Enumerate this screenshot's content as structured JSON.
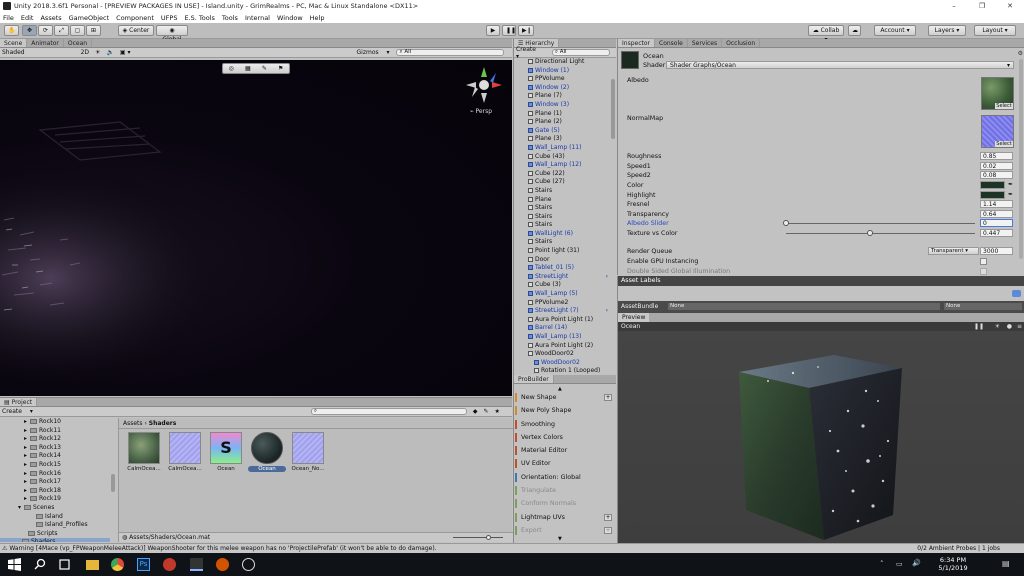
{
  "window": {
    "title": "Unity 2018.3.6f1 Personal - [PREVIEW PACKAGES IN USE] - Island.unity - GrimRealms - PC, Mac & Linux Standalone <DX11>"
  },
  "menu": [
    "File",
    "Edit",
    "Assets",
    "GameObject",
    "Component",
    "UFPS",
    "E.S. Tools",
    "Tools",
    "Internal",
    "Window",
    "Help"
  ],
  "toolbar": {
    "center": "Center",
    "global": "Global",
    "collab": "Collab",
    "account": "Account",
    "layers": "Layers",
    "layout": "Layout"
  },
  "scene": {
    "tabs": [
      "Scene",
      "Animator",
      "Ocean"
    ],
    "shading": "Shaded",
    "mode2d": "2D",
    "gizmos": "Gizmos",
    "search_placeholder": "All",
    "persp": "Persp"
  },
  "hierarchy": {
    "tab": "Hierarchy",
    "create": "Create",
    "search_placeholder": "All",
    "items": [
      {
        "label": "Directional Light",
        "prefab": false
      },
      {
        "label": "Window (1)",
        "prefab": true
      },
      {
        "label": "PPVolume",
        "prefab": false
      },
      {
        "label": "Window (2)",
        "prefab": true
      },
      {
        "label": "Plane (7)",
        "prefab": false
      },
      {
        "label": "Window (3)",
        "prefab": true
      },
      {
        "label": "Plane (1)",
        "prefab": false
      },
      {
        "label": "Plane (2)",
        "prefab": false
      },
      {
        "label": "Gate (5)",
        "prefab": true
      },
      {
        "label": "Plane (3)",
        "prefab": false
      },
      {
        "label": "Wall_Lamp (11)",
        "prefab": true
      },
      {
        "label": "Cube (43)",
        "prefab": false
      },
      {
        "label": "Wall_Lamp (12)",
        "prefab": true
      },
      {
        "label": "Cube (22)",
        "prefab": false
      },
      {
        "label": "Cube (27)",
        "prefab": false
      },
      {
        "label": "Stairs",
        "prefab": false
      },
      {
        "label": "Plane",
        "prefab": false
      },
      {
        "label": "Stairs",
        "prefab": false
      },
      {
        "label": "Stairs",
        "prefab": false
      },
      {
        "label": "Stairs",
        "prefab": false
      },
      {
        "label": "WallLight (6)",
        "prefab": true
      },
      {
        "label": "Stairs",
        "prefab": false
      },
      {
        "label": "Point light (31)",
        "prefab": false
      },
      {
        "label": "Door",
        "prefab": false
      },
      {
        "label": "Tablet_01 (5)",
        "prefab": true
      },
      {
        "label": "StreetLight",
        "prefab": true
      },
      {
        "label": "Cube (3)",
        "prefab": false
      },
      {
        "label": "Wall_Lamp (5)",
        "prefab": true
      },
      {
        "label": "PPVolume2",
        "prefab": false
      },
      {
        "label": "StreetLight (7)",
        "prefab": true
      },
      {
        "label": "Aura Point Light (1)",
        "prefab": false
      },
      {
        "label": "Barrel (14)",
        "prefab": true
      },
      {
        "label": "Wall_Lamp (13)",
        "prefab": true
      },
      {
        "label": "Aura Point Light (2)",
        "prefab": false
      },
      {
        "label": "WoodDoor02",
        "prefab": false
      },
      {
        "label": "WoodDoor02",
        "prefab": true
      },
      {
        "label": "Rotation 1 (Looped)",
        "prefab": false
      }
    ]
  },
  "probuilder": {
    "tab": "ProBuilder",
    "items": [
      {
        "label": "New Shape",
        "color": "#d08a2a",
        "plus": true,
        "disabled": false
      },
      {
        "label": "New Poly Shape",
        "color": "#d08a2a",
        "plus": false,
        "disabled": false
      },
      {
        "label": "Smoothing",
        "color": "#c0502a",
        "plus": false,
        "disabled": false
      },
      {
        "label": "Vertex Colors",
        "color": "#c0502a",
        "plus": false,
        "disabled": false
      },
      {
        "label": "Material Editor",
        "color": "#c0502a",
        "plus": false,
        "disabled": false
      },
      {
        "label": "UV Editor",
        "color": "#c0502a",
        "plus": false,
        "disabled": false
      },
      {
        "label": "Orientation: Global",
        "color": "#3a7ab0",
        "plus": false,
        "disabled": false
      },
      {
        "label": "Triangulate",
        "color": "#7aa05a",
        "plus": false,
        "disabled": true
      },
      {
        "label": "Conform Normals",
        "color": "#7aa05a",
        "plus": false,
        "disabled": true
      },
      {
        "label": "Lightmap UVs",
        "color": "#7aa05a",
        "plus": true,
        "disabled": false
      },
      {
        "label": "Export",
        "color": "#7aa05a",
        "plus": true,
        "disabled": true
      }
    ]
  },
  "inspector": {
    "tabs": [
      "Inspector",
      "Console",
      "Services",
      "Occlusion"
    ],
    "name": "Ocean",
    "shader_label": "Shader",
    "shader": "Shader Graphs/Ocean",
    "albedo": "Albedo",
    "normalmap": "NormalMap",
    "select": "Select",
    "props": [
      {
        "label": "Roughness",
        "value": "0.85",
        "kind": "num"
      },
      {
        "label": "Speed1",
        "value": "0.02",
        "kind": "num"
      },
      {
        "label": "Speed2",
        "value": "0.08",
        "kind": "num"
      },
      {
        "label": "Color",
        "value": "",
        "kind": "color"
      },
      {
        "label": "Highlight",
        "value": "",
        "kind": "color"
      },
      {
        "label": "Fresnel",
        "value": "1.14",
        "kind": "num"
      },
      {
        "label": "Transparency",
        "value": "0.64",
        "kind": "num"
      },
      {
        "label": "Albedo Slider",
        "value": "0",
        "kind": "slider",
        "fraction": 0
      },
      {
        "label": "Texture vs Color",
        "value": "0.447",
        "kind": "slider",
        "fraction": 0.447
      }
    ],
    "render_queue": "Render Queue",
    "render_queue_mode": "Transparent",
    "render_queue_value": "3000",
    "gpu": "Enable GPU Instancing",
    "dsgi": "Double Sided Global Illumination"
  },
  "asset_labels": {
    "title": "Asset Labels",
    "bundle_label": "AssetBundle",
    "bundle": "None",
    "variant": "None"
  },
  "preview": {
    "tab": "Preview",
    "name": "Ocean"
  },
  "project": {
    "tab": "Project",
    "create": "Create",
    "folders": [
      "Rock10",
      "Rock11",
      "Rock12",
      "Rock13",
      "Rock14",
      "Rock15",
      "Rock16",
      "Rock17",
      "Rock18",
      "Rock19",
      "Scenes",
      "Island",
      "Island_Profiles",
      "Scripts",
      "Shaders"
    ],
    "breadcrumb_root": "Assets",
    "breadcrumb_sep": "›",
    "breadcrumb_leaf": "Shaders",
    "assets": [
      {
        "label": "CalmOcea..."
      },
      {
        "label": "CalmOcea..."
      },
      {
        "label": "Ocean"
      },
      {
        "label": "Ocean"
      },
      {
        "label": "Ocean_No..."
      }
    ],
    "path": "Assets/Shaders/Ocean.mat"
  },
  "status": {
    "warning": "Warning [4Mace (vp_FPWeaponMeleeAttack)] WeaponShooter for this melee weapon has no 'ProjectilePrefab' (it won't be able to do damage).",
    "probes": "0/2 Ambient Probes | 1 jobs"
  },
  "taskbar": {
    "time": "6:34 PM",
    "date": "5/1/2019"
  }
}
